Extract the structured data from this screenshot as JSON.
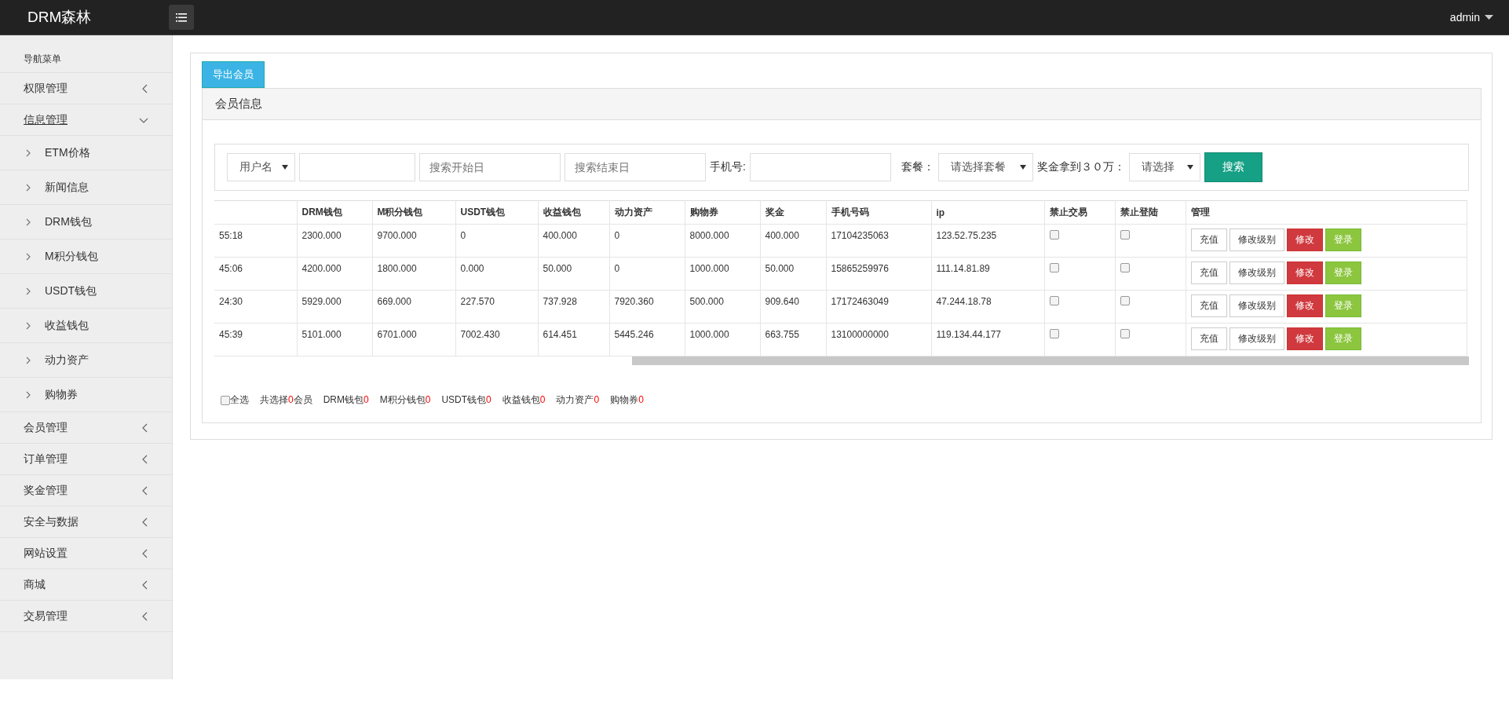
{
  "topbar": {
    "brand": "DRM森林",
    "user": "admin"
  },
  "sidebar": {
    "title": "导航菜单",
    "items": [
      {
        "label": "权限管理",
        "expanded": false,
        "selected": false
      },
      {
        "label": "信息管理",
        "expanded": true,
        "selected": true,
        "children": [
          {
            "label": "ETM价格"
          },
          {
            "label": "新闻信息"
          },
          {
            "label": "DRM钱包"
          },
          {
            "label": "M积分钱包"
          },
          {
            "label": "USDT钱包"
          },
          {
            "label": "收益钱包"
          },
          {
            "label": "动力资产"
          },
          {
            "label": "购物券"
          }
        ]
      },
      {
        "label": "会员管理",
        "expanded": false,
        "selected": false
      },
      {
        "label": "订单管理",
        "expanded": false,
        "selected": false
      },
      {
        "label": "奖金管理",
        "expanded": false,
        "selected": false
      },
      {
        "label": "安全与数据",
        "expanded": false,
        "selected": false
      },
      {
        "label": "网站设置",
        "expanded": false,
        "selected": false
      },
      {
        "label": "商城",
        "expanded": false,
        "selected": false
      },
      {
        "label": "交易管理",
        "expanded": false,
        "selected": false
      }
    ]
  },
  "export_button": "导出会员",
  "panel_title": "会员信息",
  "search": {
    "field_select": "用户名",
    "start_placeholder": "搜索开始日",
    "end_placeholder": "搜索结束日",
    "phone_label": "手机号:",
    "plan_label": "套餐：",
    "plan_select": "请选择套餐",
    "bonus_label": "奖金拿到３０万：",
    "bonus_select": "请选择",
    "button": "搜索"
  },
  "table": {
    "columns": [
      "",
      "DRM钱包",
      "M积分钱包",
      "USDT钱包",
      "收益钱包",
      "动力资产",
      "购物券",
      "奖金",
      "手机号码",
      "ip",
      "禁止交易",
      "禁止登陆",
      "管理"
    ],
    "rows": [
      {
        "cells": [
          "55:18",
          "2300.000",
          "9700.000",
          "0",
          "400.000",
          "0",
          "8000.000",
          "400.000",
          "17104235063",
          "123.52.75.235"
        ],
        "ban_trade": false,
        "ban_login": false,
        "actions": [
          {
            "label": "充值",
            "kind": "default"
          },
          {
            "label": "修改级别",
            "kind": "default"
          },
          {
            "label": "修改",
            "kind": "danger"
          },
          {
            "label": "登录",
            "kind": "success"
          }
        ]
      },
      {
        "cells": [
          "45:06",
          "4200.000",
          "1800.000",
          "0.000",
          "50.000",
          "0",
          "1000.000",
          "50.000",
          "15865259976",
          "111.14.81.89"
        ],
        "ban_trade": false,
        "ban_login": false,
        "actions": [
          {
            "label": "充值",
            "kind": "default"
          },
          {
            "label": "修改级别",
            "kind": "default"
          },
          {
            "label": "修改",
            "kind": "danger"
          },
          {
            "label": "登录",
            "kind": "success"
          }
        ]
      },
      {
        "cells": [
          "24:30",
          "5929.000",
          "669.000",
          "227.570",
          "737.928",
          "7920.360",
          "500.000",
          "909.640",
          "17172463049",
          "47.244.18.78"
        ],
        "ban_trade": false,
        "ban_login": false,
        "actions": [
          {
            "label": "充值",
            "kind": "default"
          },
          {
            "label": "修改级别",
            "kind": "default"
          },
          {
            "label": "修改",
            "kind": "danger"
          },
          {
            "label": "登录",
            "kind": "success"
          }
        ]
      },
      {
        "cells": [
          "45:39",
          "5101.000",
          "6701.000",
          "7002.430",
          "614.451",
          "5445.246",
          "1000.000",
          "663.755",
          "13100000000",
          "119.134.44.177"
        ],
        "ban_trade": false,
        "ban_login": false,
        "actions": [
          {
            "label": "充值",
            "kind": "default"
          },
          {
            "label": "修改级别",
            "kind": "default"
          },
          {
            "label": "修改",
            "kind": "danger"
          },
          {
            "label": "登录",
            "kind": "success"
          }
        ]
      }
    ]
  },
  "summary": {
    "select_all": {
      "label": "全选",
      "checked": false
    },
    "items": [
      {
        "label": "共选择",
        "value": "0",
        "suffix": "会员"
      },
      {
        "label": "DRM钱包",
        "value": "0"
      },
      {
        "label": "M积分钱包",
        "value": "0"
      },
      {
        "label": "USDT钱包",
        "value": "0"
      },
      {
        "label": "收益钱包",
        "value": "0"
      },
      {
        "label": "动力资产",
        "value": "0"
      },
      {
        "label": "购物券",
        "value": "0"
      }
    ]
  }
}
